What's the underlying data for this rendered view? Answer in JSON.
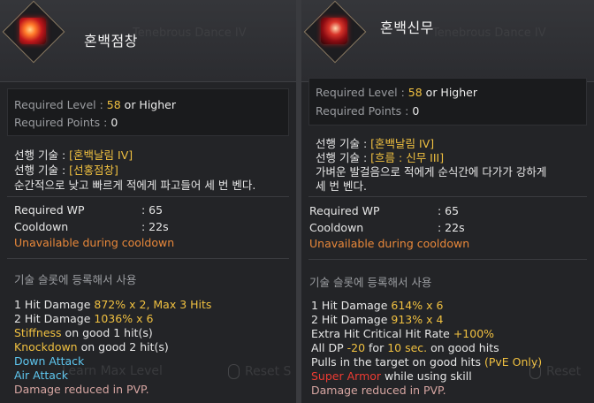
{
  "left": {
    "title": "혼백점창",
    "ghost_title": "Tenebrous Dance IV",
    "req_level_label": "Required Level",
    "req_level_value": "58",
    "req_level_suffix": "or Higher",
    "req_points_label": "Required Points",
    "req_points_value": "0",
    "prereq1_label": "선행 기술",
    "prereq1_value": "[혼백날림 IV]",
    "prereq2_label": "선행 기술",
    "prereq2_value": "[선홍점창]",
    "desc": "순간적으로 낮고 빠르게 적에게 파고들어 세 번 벤다.",
    "wp_label": "Required WP",
    "wp_value": ": 65",
    "cooldown_label": "Cooldown",
    "cooldown_value": ": 22s",
    "unavailable": "Unavailable during cooldown",
    "slot_text": "기술 슬롯에 등록해서 사용",
    "hit1_prefix": "1 Hit Damage",
    "hit1_value": "872% x 2, Max 3 Hits",
    "hit2_prefix": "2 Hit Damage",
    "hit2_value": "1036% x 6",
    "stiff_word": "Stiffness",
    "stiff_rest": "on good 1 hit(s)",
    "knock_word": "Knockdown",
    "knock_rest": "on good 2 hit(s)",
    "down_attack": "Down Attack",
    "air_attack": "Air Attack",
    "pvp": "Damage reduced in PVP.",
    "ghost_btn1": "Learn Max Level",
    "ghost_btn2": "Reset S"
  },
  "right": {
    "title": "혼백신무",
    "ghost_title": "Tenebrous Dance IV",
    "req_level_label": "Required Level",
    "req_level_value": "58",
    "req_level_suffix": "or Higher",
    "req_points_label": "Required Points",
    "req_points_value": "0",
    "prereq1_label": "선행 기술",
    "prereq1_value": "[혼백날림 IV]",
    "prereq2_label": "선행 기술",
    "prereq2_value": "[흐름 : 신무 III]",
    "desc1": "가벼운 발걸음으로 적에게 순식간에 다가가 강하게",
    "desc2": "세 번 벤다.",
    "wp_label": "Required WP",
    "wp_value": ": 65",
    "cooldown_label": "Cooldown",
    "cooldown_value": ": 22s",
    "unavailable": "Unavailable during cooldown",
    "slot_text": "기술 슬롯에 등록해서 사용",
    "hit1_prefix": "1 Hit Damage",
    "hit1_value": "614% x 6",
    "hit2_prefix": "2 Hit Damage",
    "hit2_value": "913% x 4",
    "crit_prefix": "Extra Hit Critical Hit Rate",
    "crit_value": "+100%",
    "dp_prefix": "All DP",
    "dp_value": "-20",
    "dp_for": "for",
    "dp_time": "10 sec.",
    "dp_suffix": "on good hits",
    "pull_text": "Pulls in the target on good hits",
    "pull_pve": "(PvE Only)",
    "super_armor": "Super Armor",
    "super_armor_rest": "while using skill",
    "pvp": "Damage reduced in PVP.",
    "ghost_btn": "Reset"
  }
}
